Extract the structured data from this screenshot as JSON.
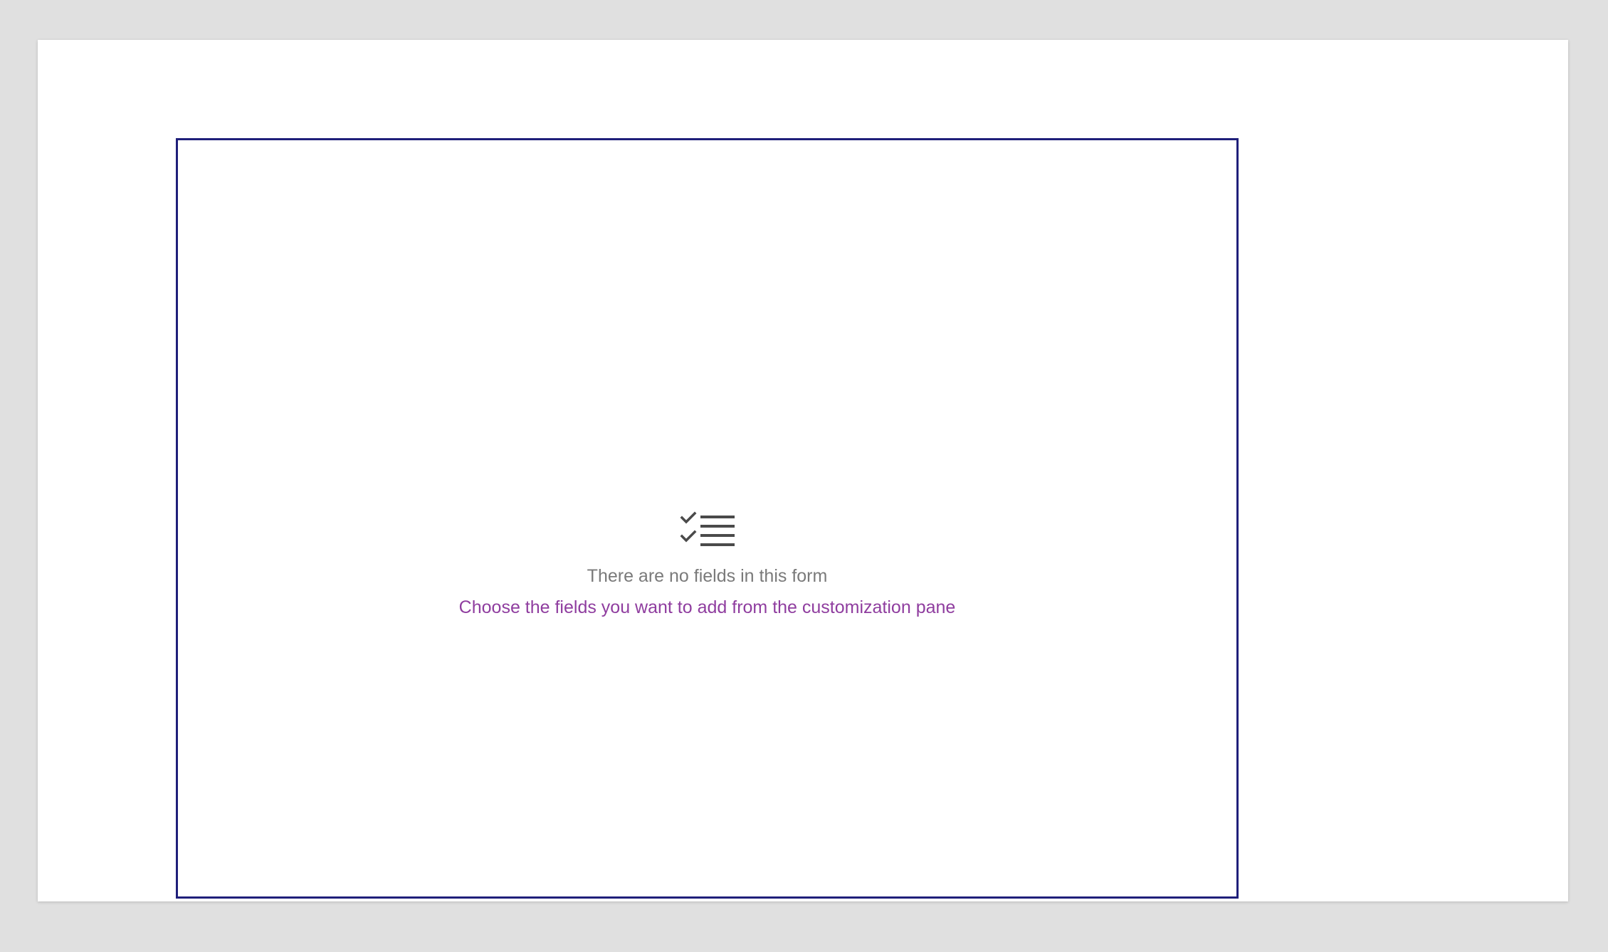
{
  "canvas": {
    "frame_border_color": "#1f1f7a"
  },
  "empty_state": {
    "icon": "checklist-icon",
    "title": "There are no fields in this form",
    "link_text": "Choose the fields you want to add from the customization pane",
    "title_color": "#7a7a7a",
    "link_color": "#8f3d9f"
  }
}
